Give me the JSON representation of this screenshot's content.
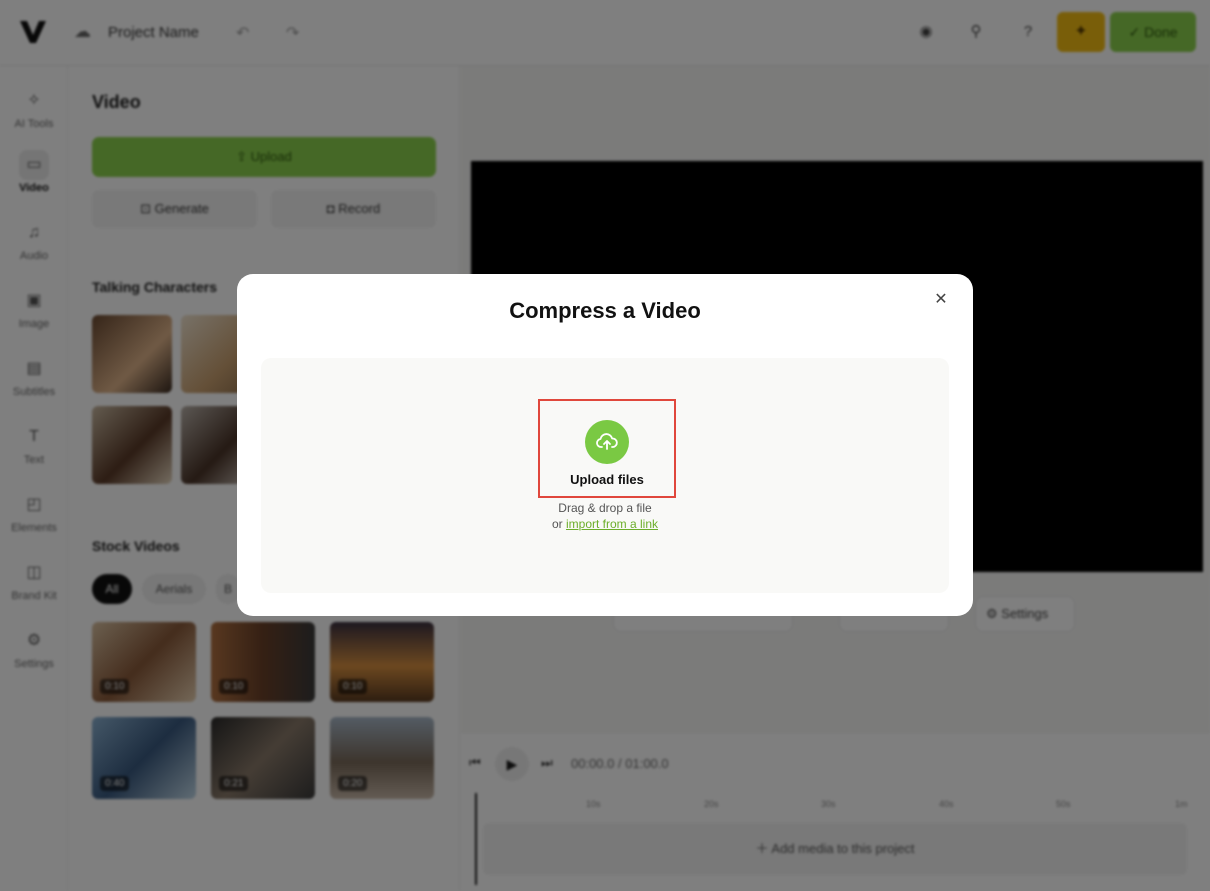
{
  "header": {
    "project_name": "Project Name",
    "done_label": "Done"
  },
  "leftnav": {
    "items": [
      {
        "label": "AI Tools",
        "icon": "sparkle-icon"
      },
      {
        "label": "Video",
        "icon": "video-icon"
      },
      {
        "label": "Audio",
        "icon": "music-note-icon"
      },
      {
        "label": "Image",
        "icon": "image-icon"
      },
      {
        "label": "Subtitles",
        "icon": "subtitles-icon"
      },
      {
        "label": "Text",
        "icon": "text-icon"
      },
      {
        "label": "Elements",
        "icon": "sticker-icon"
      },
      {
        "label": "Brand Kit",
        "icon": "brand-kit-icon"
      },
      {
        "label": "Settings",
        "icon": "gear-icon"
      }
    ]
  },
  "panel": {
    "title": "Video",
    "upload_label": "Upload",
    "generate_label": "Generate",
    "record_label": "Record",
    "talking_characters_title": "Talking Characters",
    "stock_videos_title": "Stock Videos",
    "chips": [
      "All",
      "Aerials",
      "B"
    ],
    "stock_durations": [
      "0:10",
      "0:10",
      "0:10",
      "0:40",
      "0:21",
      "0:20"
    ]
  },
  "stage": {
    "settings_label": "Settings"
  },
  "timeline": {
    "current_time": "00:00.0",
    "separator": "/",
    "total_time": "01:00.0",
    "ticks": [
      "10s",
      "20s",
      "30s",
      "40s",
      "50s",
      "1m"
    ],
    "add_media_label": "Add media to this project"
  },
  "modal": {
    "title": "Compress a Video",
    "upload_label": "Upload files",
    "drag_text": "Drag & drop a file",
    "or_text": "or",
    "link_text": "import from a link"
  },
  "colors": {
    "brand_green": "#8bd14c",
    "upload_circle": "#7ac943",
    "highlight_red": "#e0473c",
    "link_green": "#6cae2a",
    "yellow": "#f3bd13"
  }
}
